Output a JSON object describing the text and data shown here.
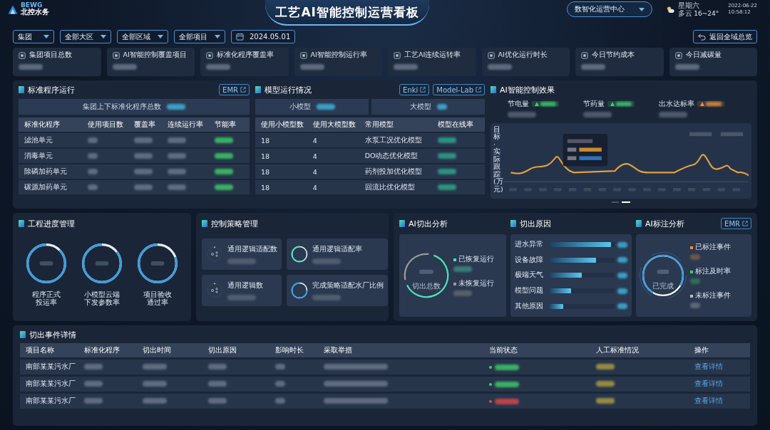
{
  "header": {
    "logo_top": "BEWG",
    "logo_bottom": "北控水务",
    "title": "工艺AI智能控制运营看板",
    "center_select": "数智化运营中心",
    "weekday": "星期六",
    "weather": "多云",
    "temp": "16~24°",
    "date": "2022-06-22",
    "time": "10:58:12"
  },
  "filters": [
    {
      "label": "集团",
      "kind": "select"
    },
    {
      "label": "全部大区",
      "kind": "select"
    },
    {
      "label": "全部区域",
      "kind": "select"
    },
    {
      "label": "全部项目",
      "kind": "select"
    },
    {
      "label": "2024.05.01",
      "kind": "date"
    }
  ],
  "back_button": "返回全域总览",
  "kpis": [
    {
      "label": "集团项目总数"
    },
    {
      "label": "AI智能控制覆盖项目"
    },
    {
      "label": "标准化程序覆盖率"
    },
    {
      "label": "AI智能控制运行率"
    },
    {
      "label": "工艺AI连续运转率"
    },
    {
      "label": "AI优化运行时长"
    },
    {
      "label": "今日节约成本"
    },
    {
      "label": "今日减碳量"
    }
  ],
  "std_program": {
    "title": "标准程序运行",
    "link": "EMR",
    "summary_label": "集团上下标准化程序总数",
    "columns": [
      "标准化程序",
      "使用项目数",
      "覆盖率",
      "连续运行率",
      "节能率"
    ],
    "rows": [
      {
        "name": "滤池单元"
      },
      {
        "name": "消毒单元"
      },
      {
        "name": "除磷加药单元"
      },
      {
        "name": "碳源加药单元"
      }
    ]
  },
  "model": {
    "title": "模型运行情况",
    "links": [
      "Enki",
      "Model-Lab"
    ],
    "small_label": "小模型",
    "large_label": "大模型",
    "columns": [
      "使用小模型数",
      "使用大模型数",
      "常用模型",
      "模型在线率"
    ],
    "rows": [
      {
        "small": "18",
        "large": "4",
        "model": "水泵工况优化模型"
      },
      {
        "small": "18",
        "large": "4",
        "model": "DO动态优化模型"
      },
      {
        "small": "18",
        "large": "4",
        "model": "药剂投加优化模型"
      },
      {
        "small": "18",
        "large": "4",
        "model": "回流比优化模型"
      }
    ]
  },
  "effect": {
    "title": "AI智能控制效果",
    "metrics": [
      {
        "label": "节电量",
        "color": "#3ecf6a"
      },
      {
        "label": "节药量",
        "color": "#3ecf6a"
      },
      {
        "label": "出水达标率",
        "color": "#e8903a"
      }
    ],
    "chart_ylabel": "目标·实际跟踪(万元)",
    "pager": [
      {
        "selected": false
      },
      {
        "selected": true
      }
    ]
  },
  "progress": {
    "title": "工程进度管理",
    "gauges": [
      {
        "lines": [
          "程序正式",
          "投运率"
        ]
      },
      {
        "lines": [
          "小模型云端",
          "下发参数率"
        ]
      },
      {
        "lines": [
          "项目验收",
          "通过率"
        ]
      }
    ]
  },
  "strategy": {
    "title": "控制策略管理",
    "items": [
      {
        "label": "通用逻辑适配数",
        "kind": "icon"
      },
      {
        "label": "通用逻辑适配率",
        "kind": "ring",
        "color": "#4fe0b8"
      },
      {
        "label": "通用逻辑数",
        "kind": "icon"
      },
      {
        "label": "完成策略适配水厂比例",
        "kind": "ring",
        "color": "#3a9de0"
      }
    ]
  },
  "cutout": {
    "title": "AI切出分析",
    "total_label": "切出总数",
    "segments": [
      {
        "label": "已恢复运行",
        "color": "#4fe0b8"
      },
      {
        "label": "未恢复运行",
        "color": "#9a9a9a"
      }
    ]
  },
  "reasons": {
    "title": "切出原因",
    "items": [
      {
        "label": "进水异常",
        "level": 0.95
      },
      {
        "label": "设备故障",
        "level": 0.72
      },
      {
        "label": "极端天气",
        "level": 0.5
      },
      {
        "label": "模型问题",
        "level": 0.34
      },
      {
        "label": "其他原因",
        "level": 0.22
      }
    ]
  },
  "annotation": {
    "title": "AI标注分析",
    "link": "EMR",
    "center_label": "已完成",
    "legend": [
      {
        "label": "已标注事件",
        "color": "#e8903a"
      },
      {
        "label": "标注及时率",
        "color": "#3ecf6a"
      },
      {
        "label": "未标注事件",
        "color": "#bbbbbb"
      }
    ]
  },
  "events": {
    "title": "切出事件详情",
    "columns": [
      "项目名称",
      "标准化程序",
      "切出时间",
      "切出原因",
      "影响时长",
      "采取举措",
      "当前状态",
      "人工标准情况",
      "操作"
    ],
    "rows": [
      {
        "project": "南部某某污水厂",
        "color": "#3ecf6a",
        "action": "查看详情"
      },
      {
        "project": "南部某某污水厂",
        "color": "#3ecf6a",
        "action": "查看详情"
      },
      {
        "project": "南部某某污水厂",
        "color": "#e04848",
        "action": "查看详情"
      }
    ]
  }
}
